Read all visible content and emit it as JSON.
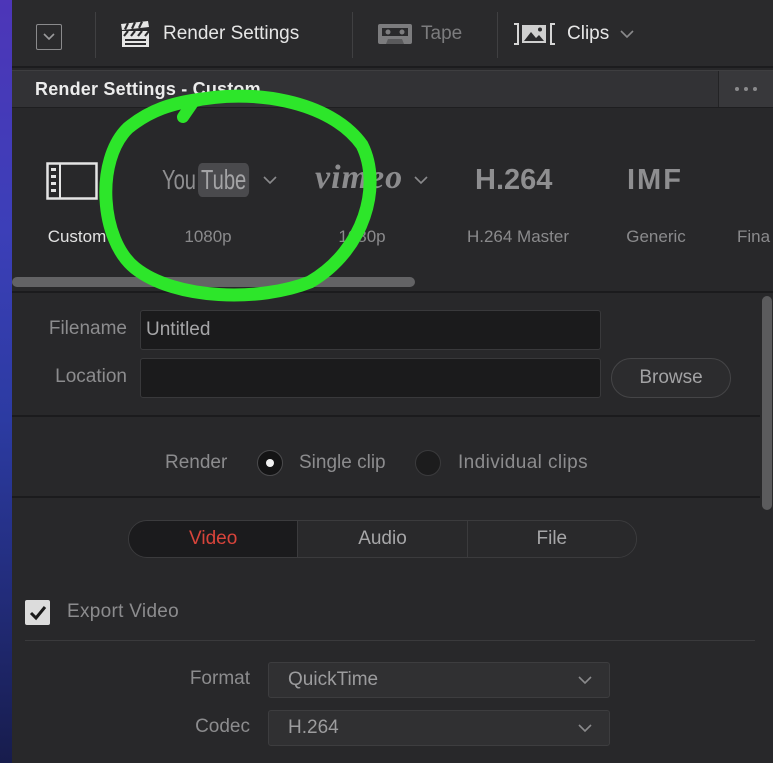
{
  "toolbar": {
    "menu_icon": "chevron-square-icon",
    "tabs": [
      {
        "label": "Render Settings",
        "icon": "clapperboard-icon",
        "disabled": false
      },
      {
        "label": "Tape",
        "icon": "tape-icon",
        "disabled": true
      },
      {
        "label": "Clips",
        "icon": "clips-bin-icon",
        "disabled": false,
        "dropdown": true
      }
    ]
  },
  "panel": {
    "title": "Render Settings - Custom",
    "options_icon": "more-options-icon"
  },
  "presets": [
    {
      "logo_icon": "film-icon",
      "label": "Custom",
      "selected": true
    },
    {
      "logo_text": [
        "You",
        "Tube"
      ],
      "label": "1080p",
      "selected": false,
      "dropdown": true
    },
    {
      "logo_text": "vimeo",
      "label": "1080p",
      "selected": false,
      "dropdown": true
    },
    {
      "logo_text": "H.264",
      "label": "H.264 Master",
      "selected": false
    },
    {
      "logo_text": "IMF",
      "label": "Generic",
      "selected": false
    },
    {
      "label": "Fina",
      "selected": false
    }
  ],
  "output": {
    "filename_label": "Filename",
    "filename_value": "Untitled",
    "location_label": "Location",
    "location_value": "",
    "browse_label": "Browse"
  },
  "render": {
    "label": "Render",
    "options": [
      {
        "label": "Single clip",
        "selected": true
      },
      {
        "label": "Individual clips",
        "selected": false
      }
    ]
  },
  "settings_tabs": [
    {
      "label": "Video",
      "active": true
    },
    {
      "label": "Audio",
      "active": false
    },
    {
      "label": "File",
      "active": false
    }
  ],
  "video": {
    "export_label": "Export Video",
    "export_checked": true,
    "format_label": "Format",
    "format_value": "QuickTime",
    "codec_label": "Codec",
    "codec_value": "H.264"
  },
  "colors": {
    "panel_bg": "#28282a",
    "active_tab_text": "#d8443b",
    "selected_text": "#e2e2e2",
    "muted_text": "#9a9a9c",
    "annotation_green": "#2de62a"
  }
}
